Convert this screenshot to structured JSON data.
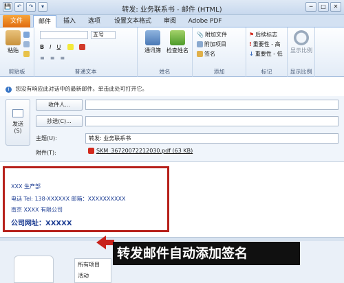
{
  "window": {
    "title": "转发: 业务联系书 - 邮件 (HTML)",
    "quick_access": [
      "💾",
      "↶",
      "↷",
      "▾"
    ],
    "controls": [
      "─",
      "□",
      "✕"
    ]
  },
  "tabs": {
    "file": "文件",
    "items": [
      "邮件",
      "插入",
      "选项",
      "设置文本格式",
      "审阅",
      "Adobe PDF"
    ]
  },
  "ribbon": {
    "clipboard": {
      "paste": "粘贴",
      "label": "剪贴板"
    },
    "text": {
      "font_size": "五号",
      "label": "普通文本"
    },
    "names": {
      "address_book": "通讯簿",
      "check_names": "检查姓名",
      "label": "姓名"
    },
    "include": {
      "attach_file": "附加文件",
      "attach_item": "附加项目",
      "signature": "签名",
      "label": "添加"
    },
    "tags": {
      "followup": "后续标志",
      "high": "重要性 - 高",
      "low": "重要性 - 低",
      "label": "标记"
    },
    "zoom": {
      "zoom": "显示比例",
      "label": "显示比例"
    }
  },
  "info_bar": "您没有响应此对话中的最新邮件。单击此处可打开它。",
  "header": {
    "send": "发送\n(S)",
    "to": "收件人...",
    "cc": "抄送(C)...",
    "subject_label": "主题(U):",
    "subject_value": "转发: 业务联系书",
    "attach_label": "附件(T):",
    "attachment": "SKM_36720072212030.pdf (63 KB)"
  },
  "signature": {
    "line1": "XXX        生产部",
    "line2": "电话 Tel: 138-XXXXXX     邮箱：XXXXXXXXXX",
    "line3": "南京 XXXX 有限公司",
    "line4": "公司网址：XXXXX"
  },
  "people_pane": {
    "all_items": "所有项目",
    "activity": "活动"
  },
  "callout": "转发邮件自动添加签名"
}
